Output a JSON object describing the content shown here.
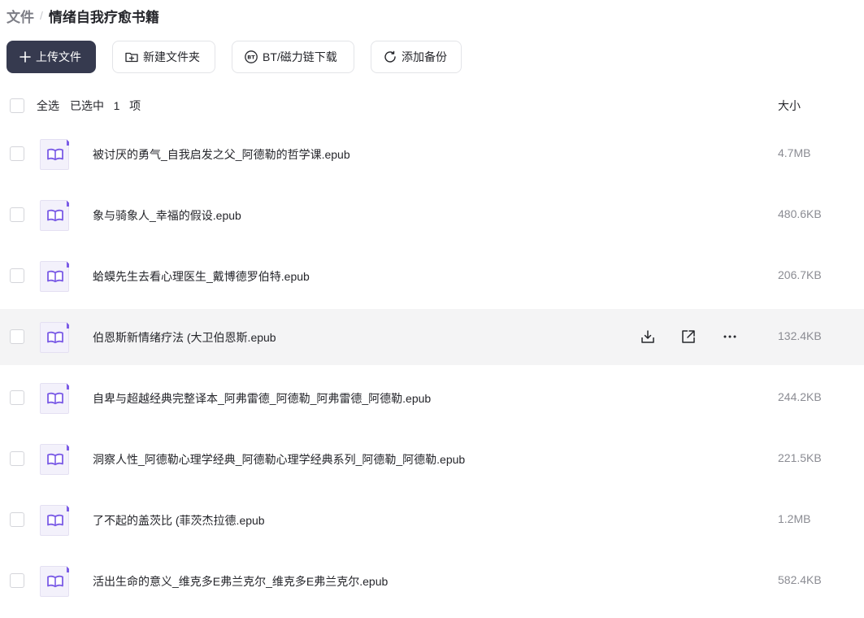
{
  "breadcrumb": {
    "root": "文件",
    "separator": "/",
    "current": "情绪自我疗愈书籍"
  },
  "toolbar": {
    "upload_label": "上传文件",
    "new_folder_label": "新建文件夹",
    "bt_label": "BT/磁力链下载",
    "backup_label": "添加备份"
  },
  "list_header": {
    "select_all": "全选",
    "selected_text": "已选中",
    "selected_count": "1",
    "selected_unit": "项",
    "size_label": "大小"
  },
  "files": [
    {
      "name": "被讨厌的勇气_自我启发之父_阿德勒的哲学课.epub",
      "size": "4.7MB"
    },
    {
      "name": "象与骑象人_幸福的假设.epub",
      "size": "480.6KB"
    },
    {
      "name": "蛤蟆先生去看心理医生_戴博德罗伯特.epub",
      "size": "206.7KB"
    },
    {
      "name": "伯恩斯新情绪疗法 (大卫伯恩斯.epub",
      "size": "132.4KB"
    },
    {
      "name": "自卑与超越经典完整译本_阿弗雷德_阿德勒_阿弗雷德_阿德勒.epub",
      "size": "244.2KB"
    },
    {
      "name": "洞察人性_阿德勒心理学经典_阿德勒心理学经典系列_阿德勒_阿德勒.epub",
      "size": "221.5KB"
    },
    {
      "name": "了不起的盖茨比 (菲茨杰拉德.epub",
      "size": "1.2MB"
    },
    {
      "name": "活出生命的意义_维克多E弗兰克尔_维克多E弗兰克尔.epub",
      "size": "582.4KB"
    }
  ],
  "colors": {
    "primary": "#363a4f",
    "file_icon_accent": "#7b5ce6",
    "hover_row": "#f4f4f5"
  },
  "icons": [
    "plus-icon",
    "folder-add-icon",
    "bt-icon",
    "refresh-icon",
    "book-icon",
    "download-icon",
    "share-icon",
    "more-icon"
  ]
}
